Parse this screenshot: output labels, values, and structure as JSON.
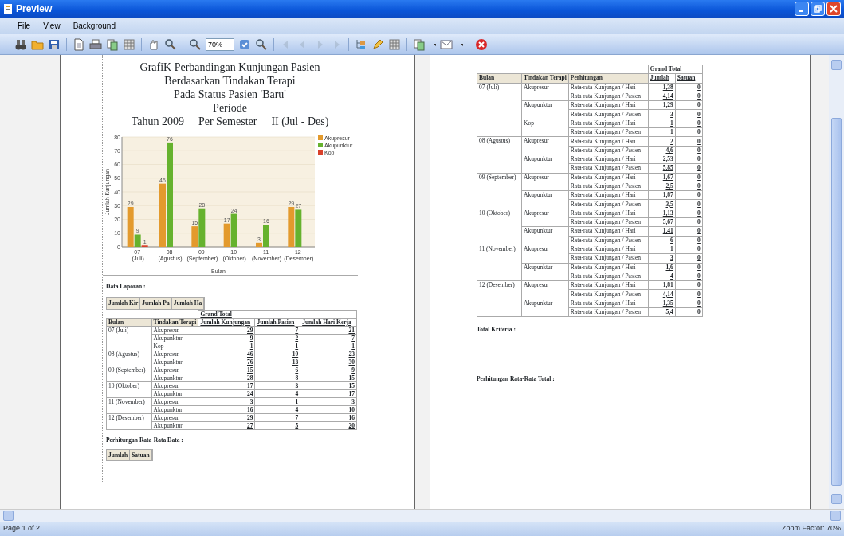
{
  "window": {
    "title": "Preview"
  },
  "menu": [
    {
      "label": "File"
    },
    {
      "label": "View"
    },
    {
      "label": "Background"
    }
  ],
  "toolbar": {
    "zoom_value": "70%"
  },
  "left_page": {
    "title_lines": [
      "GrafiK Perbandingan Kunjungan Pasien",
      "Berdasarkan Tindakan Terapi",
      "Pada Status Pasien 'Baru'",
      "Periode"
    ],
    "period_parts": [
      "Tahun 2009",
      "Per Semester",
      "II (Jul - Des)"
    ],
    "chart_data": {
      "type": "bar",
      "xlabel": "Bulan",
      "ylabel": "Jumlah Kunjungan",
      "categories": [
        "07 (Juli)",
        "08 (Agustus)",
        "09 (September)",
        "10 (Oktober)",
        "11 (November)",
        "12 (Desember)"
      ],
      "yticks": [
        0,
        10,
        20,
        30,
        40,
        50,
        60,
        70,
        80
      ],
      "ylim": [
        0,
        80
      ],
      "data_labels": true,
      "grid": true,
      "legend": true,
      "series": [
        {
          "name": "Akupresur",
          "color": "#e39a2d",
          "values": [
            29,
            46,
            15,
            17,
            3,
            29
          ]
        },
        {
          "name": "Akupunktur",
          "color": "#66b22e",
          "values": [
            9,
            76,
            28,
            24,
            16,
            27
          ]
        },
        {
          "name": "Kop",
          "color": "#d9402a",
          "values": [
            1,
            null,
            null,
            null,
            null,
            null
          ]
        }
      ]
    },
    "data_heading": "Data Laporan :",
    "field_headers": [
      "Jumlah Kir",
      "Jumlah Pa",
      "Jumlah Ha"
    ],
    "table": {
      "group_header": "Grand Total",
      "columns": [
        "Bulan",
        "Tindakan Terapi",
        "Jumlah Kunjungan",
        "Jumlah Pasien",
        "Jumlah Hari Kerja"
      ],
      "groups": [
        {
          "month": "07 (Juli)",
          "rows": [
            {
              "therapy": "Akupresur",
              "values": [
                "29",
                "7",
                "21"
              ]
            },
            {
              "therapy": "Akupunktur",
              "values": [
                "9",
                "2",
                "7"
              ]
            },
            {
              "therapy": "Kop",
              "values": [
                "1",
                "1",
                "1"
              ]
            }
          ]
        },
        {
          "month": "08 (Agustus)",
          "rows": [
            {
              "therapy": "Akupresur",
              "values": [
                "46",
                "10",
                "23"
              ]
            },
            {
              "therapy": "Akupunktur",
              "values": [
                "76",
                "13",
                "30"
              ]
            }
          ]
        },
        {
          "month": "09 (September)",
          "rows": [
            {
              "therapy": "Akupresur",
              "values": [
                "15",
                "6",
                "9"
              ]
            },
            {
              "therapy": "Akupunktur",
              "values": [
                "28",
                "8",
                "15"
              ]
            }
          ]
        },
        {
          "month": "10 (Oktober)",
          "rows": [
            {
              "therapy": "Akupresur",
              "values": [
                "17",
                "3",
                "15"
              ]
            },
            {
              "therapy": "Akupunktur",
              "values": [
                "24",
                "4",
                "17"
              ]
            }
          ]
        },
        {
          "month": "11 (November)",
          "rows": [
            {
              "therapy": "Akupresur",
              "values": [
                "3",
                "1",
                "3"
              ]
            },
            {
              "therapy": "Akupunktur",
              "values": [
                "16",
                "4",
                "10"
              ]
            }
          ]
        },
        {
          "month": "12 (Desember)",
          "rows": [
            {
              "therapy": "Akupresur",
              "values": [
                "29",
                "7",
                "16"
              ]
            },
            {
              "therapy": "Akupunktur",
              "values": [
                "27",
                "5",
                "20"
              ]
            }
          ]
        }
      ]
    },
    "avg_heading": "Perhitungan Rata-Rata Data :",
    "avg_fields": [
      "Jumlah",
      "Satuan"
    ]
  },
  "right_page": {
    "table": {
      "group_header": "Grand Total",
      "columns": [
        "Bulan",
        "Tindakan Terapi",
        "Perhitungan",
        "Jumlah",
        "Satuan"
      ],
      "groups": [
        {
          "month": "07 (Juli)",
          "therapies": [
            {
              "name": "Akupresur",
              "rows": [
                {
                  "calc": "Rata-rata Kunjungan / Hari",
                  "jumlah": "1,38",
                  "satuan": "0"
                },
                {
                  "calc": "Rata-rata Kunjungan / Pasien",
                  "jumlah": "4,14",
                  "satuan": "0"
                }
              ]
            },
            {
              "name": "Akupunktur",
              "rows": [
                {
                  "calc": "Rata-rata Kunjungan / Hari",
                  "jumlah": "1,29",
                  "satuan": "0"
                },
                {
                  "calc": "Rata-rata Kunjungan / Pasien",
                  "jumlah": "3",
                  "satuan": "0"
                }
              ]
            },
            {
              "name": "Kop",
              "rows": [
                {
                  "calc": "Rata-rata Kunjungan / Hari",
                  "jumlah": "1",
                  "satuan": "0"
                },
                {
                  "calc": "Rata-rata Kunjungan / Pasien",
                  "jumlah": "1",
                  "satuan": "0"
                }
              ]
            }
          ]
        },
        {
          "month": "08 (Agustus)",
          "therapies": [
            {
              "name": "Akupresur",
              "rows": [
                {
                  "calc": "Rata-rata Kunjungan / Hari",
                  "jumlah": "2",
                  "satuan": "0"
                },
                {
                  "calc": "Rata-rata Kunjungan / Pasien",
                  "jumlah": "4,6",
                  "satuan": "0"
                }
              ]
            },
            {
              "name": "Akupunktur",
              "rows": [
                {
                  "calc": "Rata-rata Kunjungan / Hari",
                  "jumlah": "2,53",
                  "satuan": "0"
                },
                {
                  "calc": "Rata-rata Kunjungan / Pasien",
                  "jumlah": "5,85",
                  "satuan": "0"
                }
              ]
            }
          ]
        },
        {
          "month": "09 (September)",
          "therapies": [
            {
              "name": "Akupresur",
              "rows": [
                {
                  "calc": "Rata-rata Kunjungan / Hari",
                  "jumlah": "1,67",
                  "satuan": "0"
                },
                {
                  "calc": "Rata-rata Kunjungan / Pasien",
                  "jumlah": "2,5",
                  "satuan": "0"
                }
              ]
            },
            {
              "name": "Akupunktur",
              "rows": [
                {
                  "calc": "Rata-rata Kunjungan / Hari",
                  "jumlah": "1,87",
                  "satuan": "0"
                },
                {
                  "calc": "Rata-rata Kunjungan / Pasien",
                  "jumlah": "3,5",
                  "satuan": "0"
                }
              ]
            }
          ]
        },
        {
          "month": "10 (Oktober)",
          "therapies": [
            {
              "name": "Akupresur",
              "rows": [
                {
                  "calc": "Rata-rata Kunjungan / Hari",
                  "jumlah": "1,13",
                  "satuan": "0"
                },
                {
                  "calc": "Rata-rata Kunjungan / Pasien",
                  "jumlah": "5,67",
                  "satuan": "0"
                }
              ]
            },
            {
              "name": "Akupunktur",
              "rows": [
                {
                  "calc": "Rata-rata Kunjungan / Hari",
                  "jumlah": "1,41",
                  "satuan": "0"
                },
                {
                  "calc": "Rata-rata Kunjungan / Pasien",
                  "jumlah": "6",
                  "satuan": "0"
                }
              ]
            }
          ]
        },
        {
          "month": "11 (November)",
          "therapies": [
            {
              "name": "Akupresur",
              "rows": [
                {
                  "calc": "Rata-rata Kunjungan / Hari",
                  "jumlah": "1",
                  "satuan": "0"
                },
                {
                  "calc": "Rata-rata Kunjungan / Pasien",
                  "jumlah": "3",
                  "satuan": "0"
                }
              ]
            },
            {
              "name": "Akupunktur",
              "rows": [
                {
                  "calc": "Rata-rata Kunjungan / Hari",
                  "jumlah": "1,6",
                  "satuan": "0"
                },
                {
                  "calc": "Rata-rata Kunjungan / Pasien",
                  "jumlah": "4",
                  "satuan": "0"
                }
              ]
            }
          ]
        },
        {
          "month": "12 (Desember)",
          "therapies": [
            {
              "name": "Akupresur",
              "rows": [
                {
                  "calc": "Rata-rata Kunjungan / Hari",
                  "jumlah": "1,81",
                  "satuan": "0"
                },
                {
                  "calc": "Rata-rata Kunjungan / Pasien",
                  "jumlah": "4,14",
                  "satuan": "0"
                }
              ]
            },
            {
              "name": "Akupunktur",
              "rows": [
                {
                  "calc": "Rata-rata Kunjungan / Hari",
                  "jumlah": "1,35",
                  "satuan": "0"
                },
                {
                  "calc": "Rata-rata Kunjungan / Pasien",
                  "jumlah": "5,4",
                  "satuan": "0"
                }
              ]
            }
          ]
        }
      ]
    },
    "total_heading": "Total Kriteria :",
    "avg_total_heading": "Perhitungan Rata-Rata Total :"
  },
  "status_bar": {
    "page": "Page 1 of 2",
    "zoom": "Zoom Factor: 70%"
  }
}
